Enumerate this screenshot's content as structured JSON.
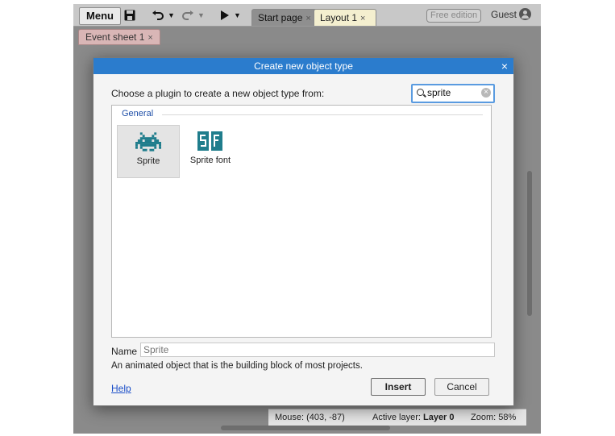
{
  "toolbar": {
    "menu_label": "Menu",
    "save_icon": "save-icon",
    "undo_icon": "undo-icon",
    "redo_icon": "redo-icon",
    "run_icon": "play-icon"
  },
  "tabs": [
    {
      "label": "Start page",
      "close": "×"
    },
    {
      "label": "Layout 1",
      "close": "×"
    }
  ],
  "event_tab": {
    "label": "Event sheet 1",
    "close": "×"
  },
  "account": {
    "edition": "Free edition",
    "user": "Guest"
  },
  "status": {
    "mouse": "Mouse: (403, -87)",
    "active_layer_label": "Active layer:",
    "active_layer_value": "Layer 0",
    "zoom": "Zoom: 58%"
  },
  "dialog": {
    "title": "Create new object type",
    "close": "×",
    "prompt": "Choose a plugin to create a new object type from:",
    "search_value": "sprite",
    "group": "General",
    "plugins": [
      {
        "label": "Sprite",
        "icon": "space-invader-icon",
        "selected": true
      },
      {
        "label": "Sprite font",
        "icon": "sprite-font-icon",
        "icon_text": "SF",
        "selected": false
      }
    ],
    "name_label": "Name",
    "name_placeholder": "Sprite",
    "description": "An animated object that is the building block of most projects.",
    "help_label": "Help",
    "insert_label": "Insert",
    "cancel_label": "Cancel"
  },
  "colors": {
    "title_bar": "#2b7ccd",
    "icon_teal": "#1f7d8c",
    "group_label": "#1f4fa8"
  }
}
